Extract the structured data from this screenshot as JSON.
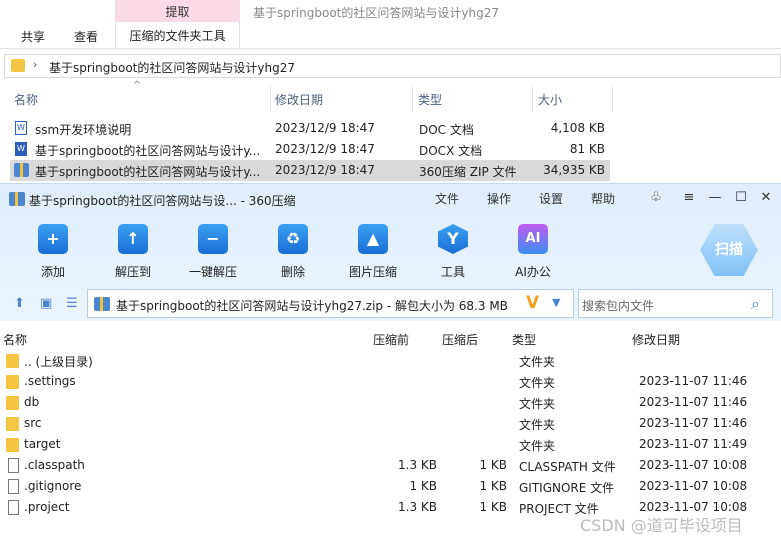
{
  "explorer": {
    "ribbon": {
      "extract_tab": "提取",
      "window_title": "基于springboot的社区问答网站与设计yhg27",
      "tabs": [
        "共享",
        "查看",
        "压缩的文件夹工具"
      ]
    },
    "address": "基于springboot的社区问答网站与设计yhg27",
    "columns": {
      "name": "名称",
      "modified": "修改日期",
      "type": "类型",
      "size": "大小"
    },
    "files": [
      {
        "name": "ssm开发环境说明",
        "modified": "2023/12/9 18:47",
        "type": "DOC 文档",
        "size": "4,108 KB",
        "icon": "word-doc-icon"
      },
      {
        "name": "基于springboot的社区问答网站与设计y...",
        "modified": "2023/12/9 18:47",
        "type": "DOCX 文档",
        "size": "81 KB",
        "icon": "word-docx-icon"
      },
      {
        "name": "基于springboot的社区问答网站与设计y...",
        "modified": "2023/12/9 18:47",
        "type": "360压缩 ZIP 文件",
        "size": "34,935 KB",
        "icon": "zip-icon"
      }
    ]
  },
  "zip_window": {
    "title": "基于springboot的社区问答网站与设... - 360压缩",
    "menu": [
      "文件",
      "操作",
      "设置",
      "帮助"
    ],
    "tools": [
      {
        "label": "添加",
        "glyph": "+"
      },
      {
        "label": "解压到",
        "glyph": "↑"
      },
      {
        "label": "一键解压",
        "glyph": "−"
      },
      {
        "label": "删除",
        "glyph": "♻"
      },
      {
        "label": "图片压缩",
        "glyph": "▲"
      },
      {
        "label": "工具",
        "glyph": "Y"
      },
      {
        "label": "AI办公",
        "glyph": "AI"
      }
    ],
    "scan_label": "扫描",
    "path": "基于springboot的社区问答网站与设计yhg27.zip - 解包大小为 68.3 MB",
    "search_placeholder": "搜索包内文件",
    "columns": {
      "name": "名称",
      "compressed": "压缩前",
      "after": "压缩后",
      "type": "类型",
      "modified": "修改日期"
    },
    "rows": [
      {
        "name": ".. (上级目录)",
        "before": "",
        "after": "",
        "type": "文件夹",
        "modified": "",
        "kind": "folder"
      },
      {
        "name": ".settings",
        "before": "",
        "after": "",
        "type": "文件夹",
        "modified": "2023-11-07 11:46",
        "kind": "folder"
      },
      {
        "name": "db",
        "before": "",
        "after": "",
        "type": "文件夹",
        "modified": "2023-11-07 11:46",
        "kind": "folder"
      },
      {
        "name": "src",
        "before": "",
        "after": "",
        "type": "文件夹",
        "modified": "2023-11-07 11:46",
        "kind": "folder"
      },
      {
        "name": "target",
        "before": "",
        "after": "",
        "type": "文件夹",
        "modified": "2023-11-07 11:49",
        "kind": "folder"
      },
      {
        "name": ".classpath",
        "before": "1.3 KB",
        "after": "1 KB",
        "type": "CLASSPATH 文件",
        "modified": "2023-11-07 10:08",
        "kind": "file"
      },
      {
        "name": ".gitignore",
        "before": "1 KB",
        "after": "1 KB",
        "type": "GITIGNORE 文件",
        "modified": "2023-11-07 10:08",
        "kind": "file"
      },
      {
        "name": ".project",
        "before": "1.3 KB",
        "after": "1 KB",
        "type": "PROJECT 文件",
        "modified": "2023-11-07 10:08",
        "kind": "file"
      }
    ]
  },
  "watermark": "CSDN @道可毕设项目"
}
